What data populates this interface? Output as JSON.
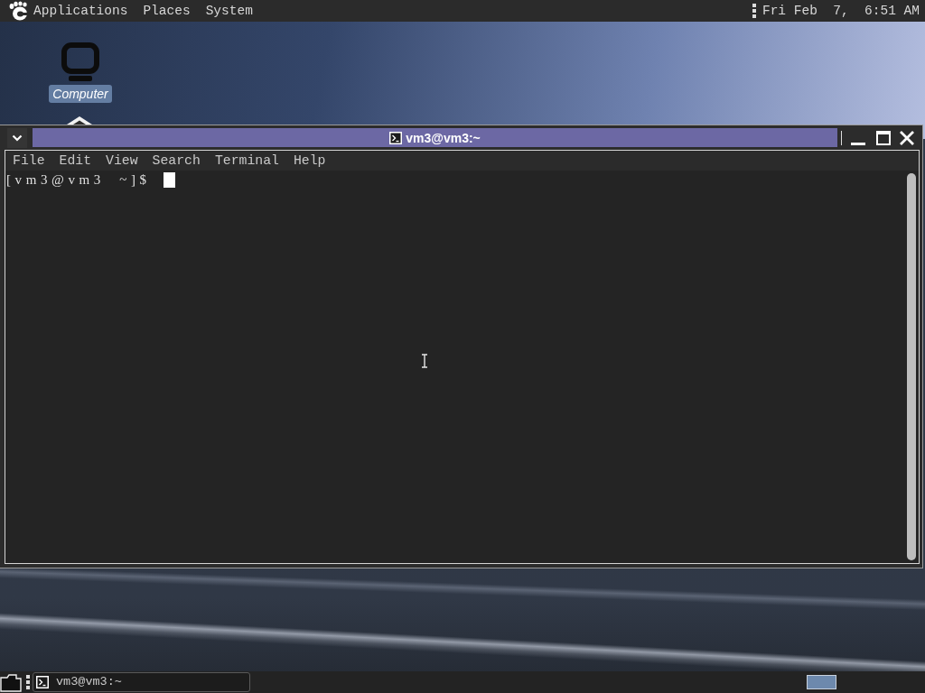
{
  "top_panel": {
    "menus": [
      "Applications",
      "Places",
      "System"
    ],
    "clock": "Fri Feb  7,  6:51 AM"
  },
  "desktop_icons": [
    {
      "label": "Computer",
      "selected": true
    }
  ],
  "terminal_window": {
    "title": "vm3@vm3:~",
    "menu": [
      "File",
      "Edit",
      "View",
      "Search",
      "Terminal",
      "Help"
    ],
    "lines": [
      "[vm3@vm3 ~]$"
    ]
  },
  "taskbar": {
    "windows": [
      {
        "label": "vm3@vm3:~"
      }
    ]
  }
}
